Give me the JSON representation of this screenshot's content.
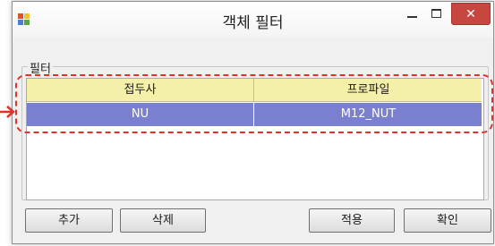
{
  "window": {
    "title": "객체 필터",
    "minimize_label": "",
    "close_label": "✕"
  },
  "group": {
    "label": "필터"
  },
  "grid": {
    "columns": [
      "접두사",
      "프로파일"
    ],
    "rows": [
      [
        "NU",
        "M12_NUT"
      ]
    ]
  },
  "buttons": {
    "add": "추가",
    "delete": "삭제",
    "apply": "적용",
    "ok": "확인"
  },
  "colors": {
    "header_bg": "#f5f0a9",
    "selected_row_bg": "#7b7fd0",
    "close_button_bg": "#c7463f",
    "annotation": "#e0312a"
  }
}
